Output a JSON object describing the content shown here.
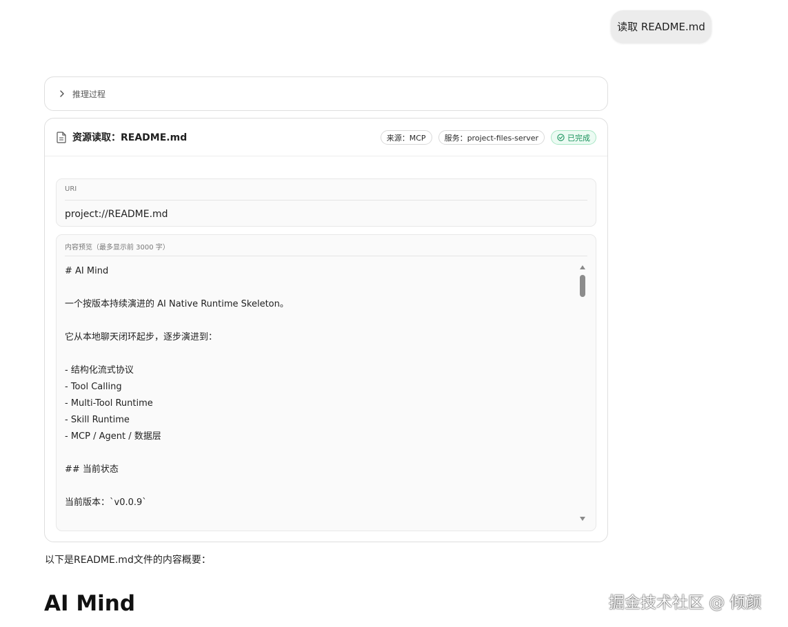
{
  "user_message": {
    "text": "读取 README.md"
  },
  "reasoning": {
    "label": "推理过程",
    "icon": "chevron-right-icon"
  },
  "tool_card": {
    "icon": "document-icon",
    "title": "资源读取：README.md",
    "badges": {
      "source": "来源：MCP",
      "service": "服务：project-files-server",
      "status": "已完成"
    },
    "status_color": "#17915a",
    "uri": {
      "label": "URI",
      "value": "project://README.md"
    },
    "preview": {
      "label": "内容预览（最多显示前 3000 字）",
      "lines": [
        "# AI Mind",
        "",
        "一个按版本持续演进的 AI Native Runtime Skeleton。",
        "",
        "它从本地聊天闭环起步，逐步演进到：",
        "",
        "- 结构化流式协议",
        "- Tool Calling",
        "- Multi-Tool Runtime",
        "- Skill Runtime",
        "- MCP / Agent / 数据层",
        "",
        "## 当前状态",
        "",
        "当前版本：`v0.0.9`"
      ]
    }
  },
  "assistant": {
    "summary": "以下是README.md文件的内容概要：",
    "heading": "AI Mind"
  },
  "watermark": "掘金技术社区 @ 倾颜"
}
